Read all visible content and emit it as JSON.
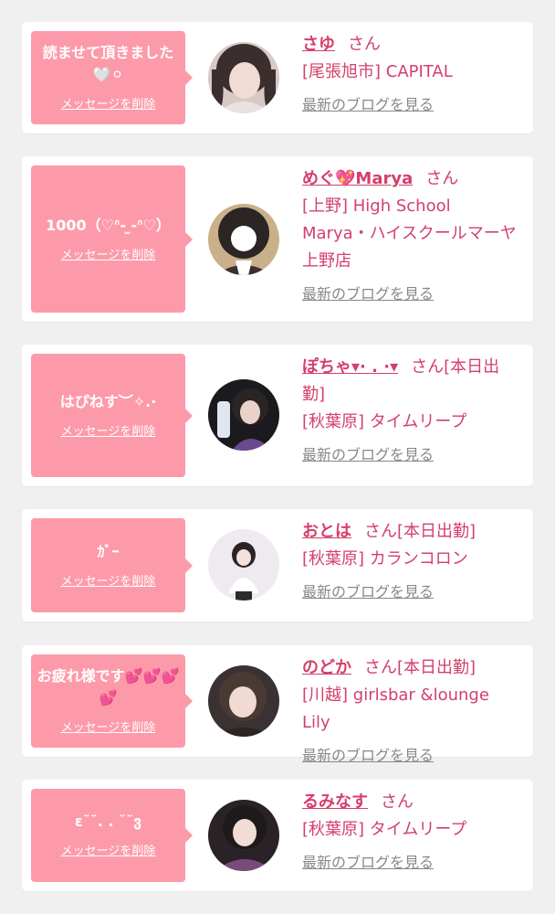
{
  "colors": {
    "bubble": "#fd9aa9",
    "accent": "#d43f6b",
    "link_gray": "#888888",
    "background": "#f0f0f0"
  },
  "items": [
    {
      "message": "読ませて頂きました🤍⚪︎",
      "delete_label": "メッセージを削除",
      "name": "さゆ",
      "san": "さん",
      "status": "",
      "shop": "[尾張旭市] CAPITAL",
      "blog_label": "最新のブログを見る"
    },
    {
      "message": "1000（♡ᐢ- ̫-ᐢ♡）",
      "delete_label": "メッセージを削除",
      "name": "めぐ💖Marya",
      "san": "さん",
      "status": "",
      "shop": "[上野] High School Marya・ハイスクールマーヤ上野店",
      "blog_label": "最新のブログを見る"
    },
    {
      "message": "はぴねす︶✧.·",
      "delete_label": "メッセージを削除",
      "name": "ぽちゃ▾· . ·▾",
      "san": "さん",
      "status": "[本日出勤]",
      "shop": "[秋葉原] タイムリープ",
      "blog_label": "最新のブログを見る"
    },
    {
      "message": "ｶﾞｰ",
      "delete_label": "メッセージを削除",
      "name": "おとは",
      "san": "さん",
      "status": "[本日出勤]",
      "shop": "[秋葉原] カランコロン",
      "blog_label": "最新のブログを見る"
    },
    {
      "message": "お疲れ様です💕💕💕💕",
      "delete_label": "メッセージを削除",
      "name": "のどか",
      "san": "さん",
      "status": "[本日出勤]",
      "shop": "[川越] girlsbar &lounge Lily",
      "blog_label": "最新のブログを見る"
    },
    {
      "message": "ε˘˘. . ˘˘ვ",
      "delete_label": "メッセージを削除",
      "name": "るみなす",
      "san": "さん",
      "status": "",
      "shop": "[秋葉原] タイムリープ",
      "blog_label": "最新のブログを見る"
    }
  ]
}
